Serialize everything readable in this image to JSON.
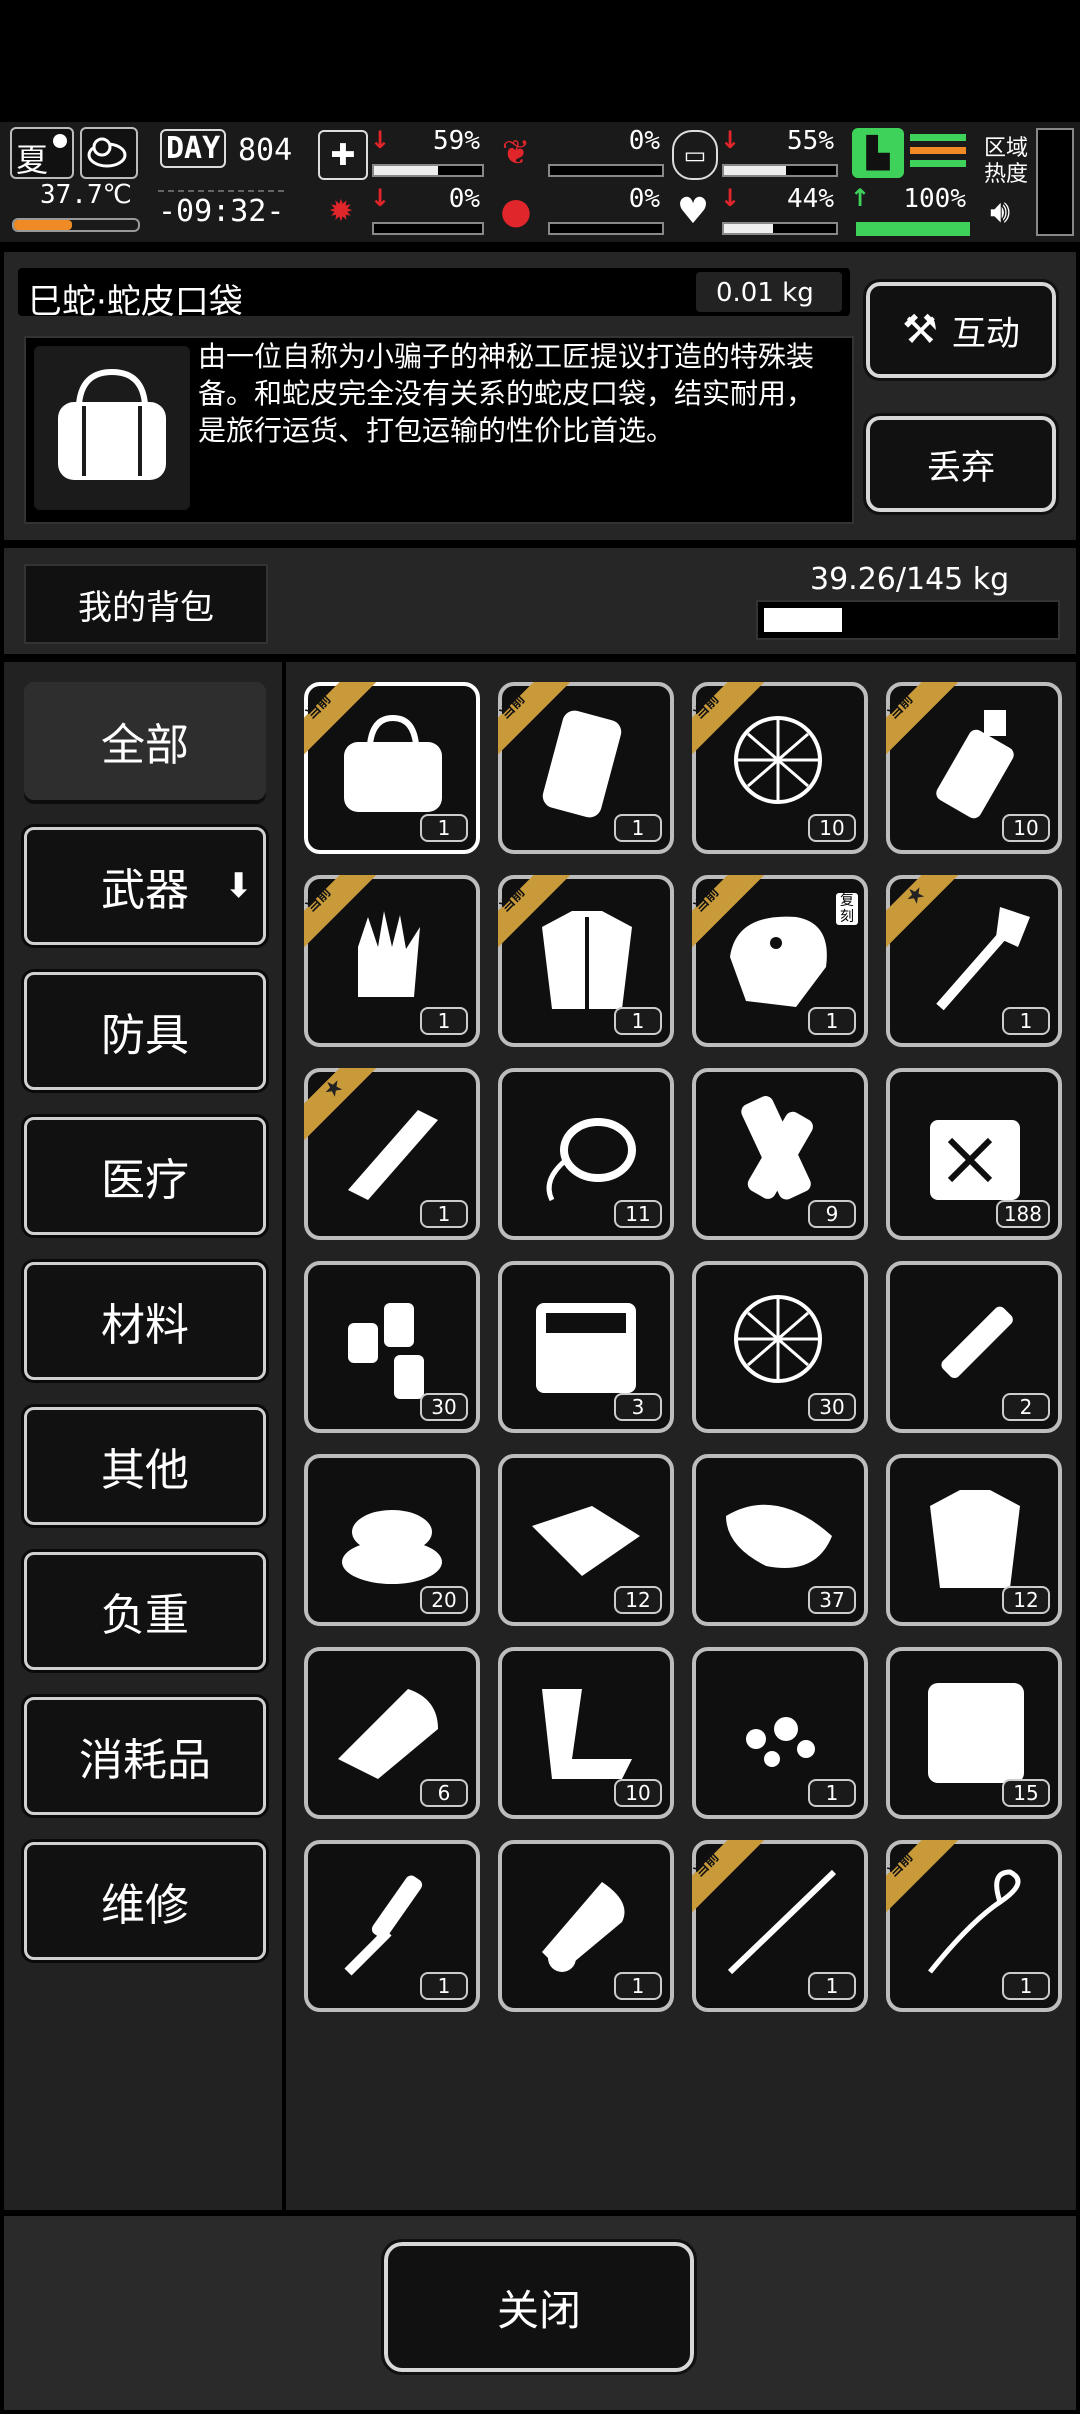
{
  "status": {
    "season": "夏",
    "temperature": "37.7℃",
    "day_label": "DAY",
    "day_number": "804",
    "time": "-09:32-",
    "stats": [
      {
        "name": "health",
        "pct": "59%",
        "fill": 0.59
      },
      {
        "name": "hunger",
        "pct": "0%",
        "fill": 0
      },
      {
        "name": "bottle",
        "pct": "55%",
        "fill": 0.55
      },
      {
        "name": "sickness",
        "pct": "0%",
        "fill": 0
      },
      {
        "name": "blood",
        "pct": "0%",
        "fill": 0
      },
      {
        "name": "heart",
        "pct": "44%",
        "fill": 0.44
      }
    ],
    "stamina_pct": "100%",
    "region_label": "区域热度"
  },
  "item": {
    "name": "巳蛇·蛇皮口袋",
    "weight": "0.01 kg",
    "description": "由一位自称为小骗子的神秘工匠提议打造的特殊装备。和蛇皮完全没有关系的蛇皮口袋，结实耐用，是旅行运货、打包运输的性价比首选。",
    "interact_label": "互动",
    "discard_label": "丢弃"
  },
  "backpack": {
    "label": "我的背包",
    "capacity": "39.26/145 kg",
    "fill": 0.27
  },
  "categories": [
    "全部",
    "武器",
    "防具",
    "医疗",
    "材料",
    "其他",
    "负重",
    "消耗品",
    "维修"
  ],
  "slots": [
    {
      "icon": "bag-icon",
      "count": "1",
      "badge": "当前"
    },
    {
      "icon": "backpack-icon",
      "count": "1",
      "badge": "当前"
    },
    {
      "icon": "net-icon",
      "count": "10",
      "badge": "当前"
    },
    {
      "icon": "flask-icon",
      "count": "10",
      "badge": "当前"
    },
    {
      "icon": "glove-icon",
      "count": "1",
      "badge": "当前"
    },
    {
      "icon": "jacket-icon",
      "count": "1",
      "badge": "当前"
    },
    {
      "icon": "dino-mask-icon",
      "count": "1",
      "badge": "当前",
      "extra": "复刻"
    },
    {
      "icon": "shovel-icon",
      "count": "1",
      "badge": "star"
    },
    {
      "icon": "tool-icon",
      "count": "1",
      "badge": "star"
    },
    {
      "icon": "rope-icon",
      "count": "11"
    },
    {
      "icon": "bandage-roll-icon",
      "count": "9"
    },
    {
      "icon": "fuel-can-icon",
      "count": "188"
    },
    {
      "icon": "bottles-icon",
      "count": "30"
    },
    {
      "icon": "toolbox-icon",
      "count": "3"
    },
    {
      "icon": "net-icon",
      "count": "30"
    },
    {
      "icon": "syringe-icon",
      "count": "2"
    },
    {
      "icon": "cloth-pile-icon",
      "count": "20"
    },
    {
      "icon": "cloth-sheet-icon",
      "count": "12"
    },
    {
      "icon": "meat-icon",
      "count": "37"
    },
    {
      "icon": "torn-shirt-icon",
      "count": "12"
    },
    {
      "icon": "towel-icon",
      "count": "6"
    },
    {
      "icon": "scrap-metal-icon",
      "count": "10"
    },
    {
      "icon": "rubble-icon",
      "count": "1"
    },
    {
      "icon": "blanket-icon",
      "count": "15"
    },
    {
      "icon": "rasp-icon",
      "count": "1"
    },
    {
      "icon": "paper-roll-icon",
      "count": "1"
    },
    {
      "icon": "spear-icon",
      "count": "1",
      "badge": "当前"
    },
    {
      "icon": "whip-icon",
      "count": "1",
      "badge": "当前"
    }
  ],
  "close_label": "关闭",
  "colors": {
    "badge": "#c89a3a",
    "health_red": "#e0252b",
    "stamina_green": "#3ed25a",
    "stamina_orange": "#f08a24"
  }
}
